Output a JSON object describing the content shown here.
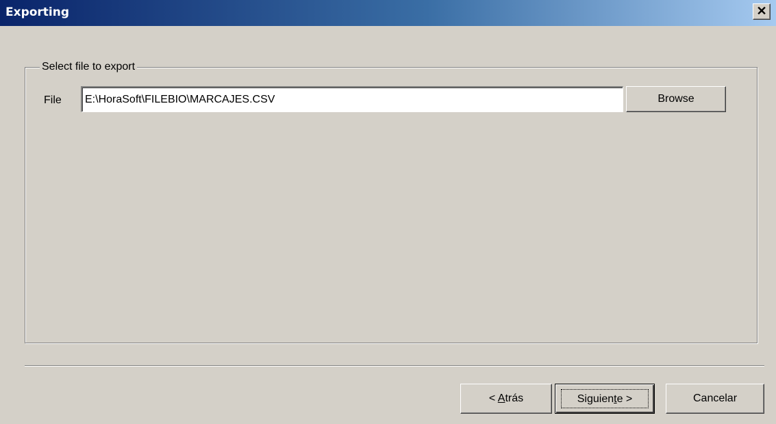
{
  "window": {
    "title": "Exporting",
    "close_glyph": "✕"
  },
  "group": {
    "legend": "Select file to export",
    "file_label": "File",
    "file_value": "E:\\HoraSoft\\FILEBIO\\MARCAJES.CSV",
    "browse_label": "Browse"
  },
  "footer": {
    "back_prefix": "< ",
    "back_mnemonic": "A",
    "back_rest": "trás",
    "next_pre": "Siguien",
    "next_mnemonic": "t",
    "next_post": "e >",
    "cancel_label": "Cancelar"
  },
  "colors": {
    "titlebar_start": "#0a246a",
    "titlebar_end": "#a6caf0",
    "face": "#d4d0c8"
  }
}
